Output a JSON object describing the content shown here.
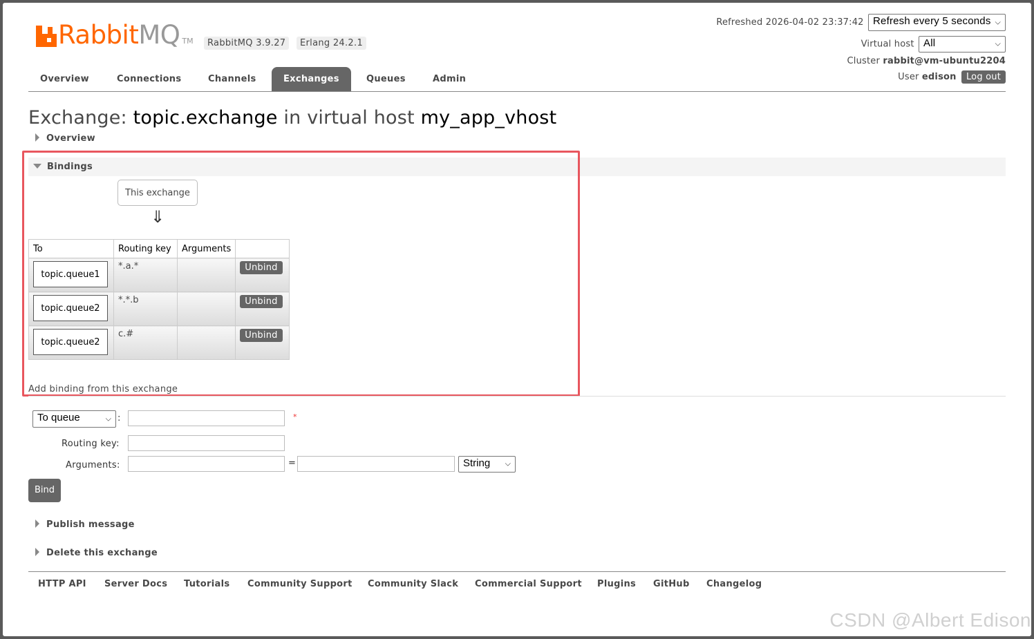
{
  "header": {
    "logo_rabbit": "Rabbit",
    "logo_mq": "MQ",
    "logo_tm": "TM",
    "version_badge": "RabbitMQ 3.9.27",
    "erlang_badge": "Erlang 24.2.1",
    "refreshed_label": "Refreshed 2026-04-02 23:37:42",
    "refresh_select": "Refresh every 5 seconds",
    "vhost_label": "Virtual host",
    "vhost_select": "All",
    "cluster_label": "Cluster",
    "cluster_value": "rabbit@vm-ubuntu2204",
    "user_label": "User",
    "user_value": "edison",
    "logout_label": "Log out"
  },
  "tabs": [
    "Overview",
    "Connections",
    "Channels",
    "Exchanges",
    "Queues",
    "Admin"
  ],
  "active_tab": "Exchanges",
  "title": {
    "prefix": "Exchange:",
    "exchange": "topic.exchange",
    "middle": "in virtual host",
    "vhost": "my_app_vhost"
  },
  "sections": {
    "overview": "Overview",
    "bindings": "Bindings",
    "publish": "Publish message",
    "delete": "Delete this exchange"
  },
  "bindings": {
    "this_exchange": "This exchange",
    "arrow": "⇓",
    "columns": [
      "To",
      "Routing key",
      "Arguments",
      ""
    ],
    "rows": [
      {
        "to": "topic.queue1",
        "routing_key": "*.a.*",
        "arguments": "",
        "action": "Unbind"
      },
      {
        "to": "topic.queue2",
        "routing_key": "*.*.b",
        "arguments": "",
        "action": "Unbind"
      },
      {
        "to": "topic.queue2",
        "routing_key": "c.#",
        "arguments": "",
        "action": "Unbind"
      }
    ],
    "add_binding": "Add binding from this exchange"
  },
  "form": {
    "to_select": "To queue",
    "colon": ":",
    "required": "*",
    "routing_key_label": "Routing key:",
    "arguments_label": "Arguments:",
    "equals": "=",
    "type_select": "String",
    "bind_button": "Bind"
  },
  "footer": [
    "HTTP API",
    "Server Docs",
    "Tutorials",
    "Community Support",
    "Community Slack",
    "Commercial Support",
    "Plugins",
    "GitHub",
    "Changelog"
  ],
  "watermark": "CSDN @Albert Edison",
  "colors": {
    "brand": "#ff6600",
    "highlight": "#e8565e",
    "tab_active": "#666666"
  }
}
